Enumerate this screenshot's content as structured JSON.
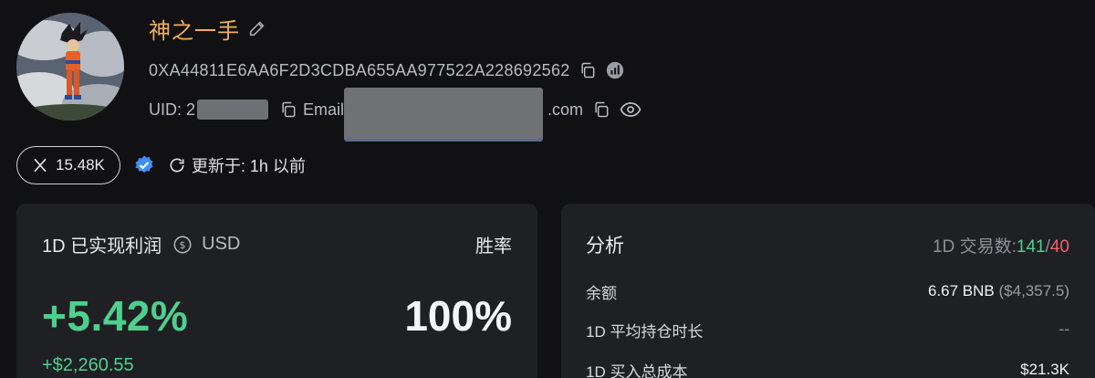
{
  "profile": {
    "name": "神之一手",
    "address": "0XA44811E6AA6F2D3CDBA655AA977522A228692562",
    "uid_label": "UID: 2",
    "email_label": "Email:",
    "email_suffix": ".com"
  },
  "social": {
    "x_followers": "15.48K",
    "updated_label": "更新于: 1h 以前"
  },
  "pnl_card": {
    "title": "1D 已实现利润",
    "currency": "USD",
    "winrate_label": "胜率",
    "pnl_percent": "+5.42%",
    "pnl_usd": "+$2,260.55",
    "winrate": "100%"
  },
  "analysis_card": {
    "title": "分析",
    "trades_label": "1D 交易数:",
    "buys": "141",
    "separator": "/",
    "sells": "40",
    "rows": [
      {
        "label": "余额",
        "value": "6.67 BNB",
        "sub": "($4,357.5)"
      },
      {
        "label": "1D 平均持仓时长",
        "value": "--"
      },
      {
        "label": "1D 买入总成本",
        "value": "$21.3K"
      }
    ]
  },
  "colors": {
    "accent_name": "#f0b05a",
    "positive": "#4fcf8e",
    "negative": "#f0616d",
    "background": "#111114",
    "card": "#1f2024"
  },
  "icons": [
    "edit-icon",
    "copy-icon",
    "chart-icon",
    "eye-icon",
    "x-logo-icon",
    "verified-badge-icon",
    "refresh-icon",
    "currency-switch-icon"
  ]
}
